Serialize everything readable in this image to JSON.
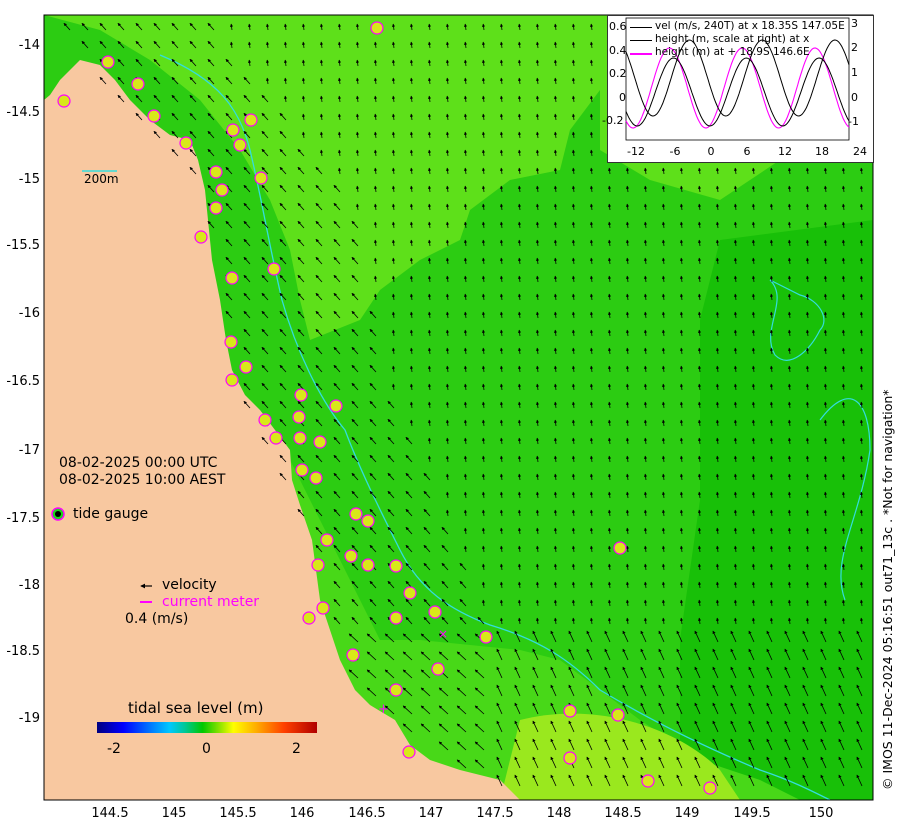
{
  "map": {
    "y_ticks": [
      "-14",
      "-14.5",
      "-15",
      "-15.5",
      "-16",
      "-16.5",
      "-17",
      "-17.5",
      "-18",
      "-18.5",
      "-19"
    ],
    "x_ticks": [
      "144.5",
      "145",
      "145.5",
      "146",
      "146.5",
      "147",
      "147.5",
      "148",
      "148.5",
      "149",
      "149.5",
      "150"
    ],
    "scale_bar_label": "200m",
    "time_utc": "08-02-2025 00:00 UTC",
    "time_aest": "08-02-2025 10:00 AEST",
    "tide_gauge_label": "tide gauge",
    "velocity_label": "velocity",
    "current_meter_label": "current meter",
    "velocity_scale_label": "0.4 (m/s)",
    "colorbar_title": "tidal sea level (m)",
    "colorbar_ticks": [
      "-2",
      "0",
      "2"
    ],
    "credit": "© IMOS 11-Dec-2024 05:16:51 out71_13c . *Not for navigation*",
    "colors": {
      "land": "#f8c8a0",
      "sea_shelf": "#5ee01a",
      "sea_deep": "#2ccc12",
      "isobath": "#33dddd",
      "gauge_ring": "#ff00ff"
    }
  },
  "timeseries": {
    "legend": [
      "vel (m/s, 240T) at x 18.35S 147.05E",
      "height (m, scale at right) at x",
      "height (m) at + 18.9S 146.6E"
    ],
    "y_left_ticks": [
      "0.6",
      "0.4",
      "0.2",
      "0",
      "-0.2"
    ],
    "y_right_ticks": [
      "3",
      "2",
      "1",
      "0",
      "-1"
    ],
    "x_ticks": [
      "-12",
      "-6",
      "0",
      "6",
      "12",
      "18",
      "24"
    ]
  }
}
